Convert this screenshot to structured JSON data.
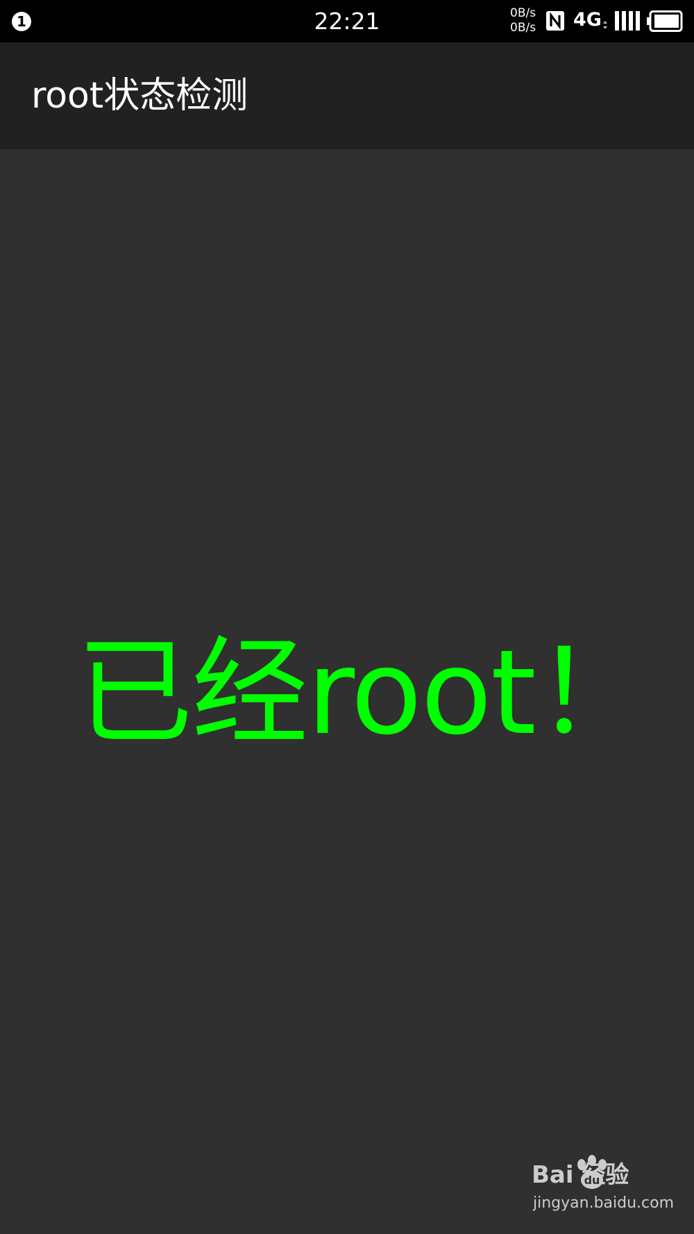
{
  "status_bar": {
    "notification_count": "1",
    "time": "22:21",
    "upload_speed": "0B/s",
    "download_speed": "0B/s",
    "network_type": "4G",
    "icons": [
      "nfc-icon",
      "signal-icon",
      "battery-icon"
    ]
  },
  "app_bar": {
    "title": "root状态检测"
  },
  "main": {
    "status_text": "已经root！"
  },
  "watermark": {
    "brand": "Bai  经验",
    "url": "jingyan.baidu.com"
  },
  "colors": {
    "status_bar_bg": "#000000",
    "app_bar_bg": "#212121",
    "content_bg": "#303030",
    "status_text": "#00ff00",
    "title_text": "#ffffff"
  }
}
